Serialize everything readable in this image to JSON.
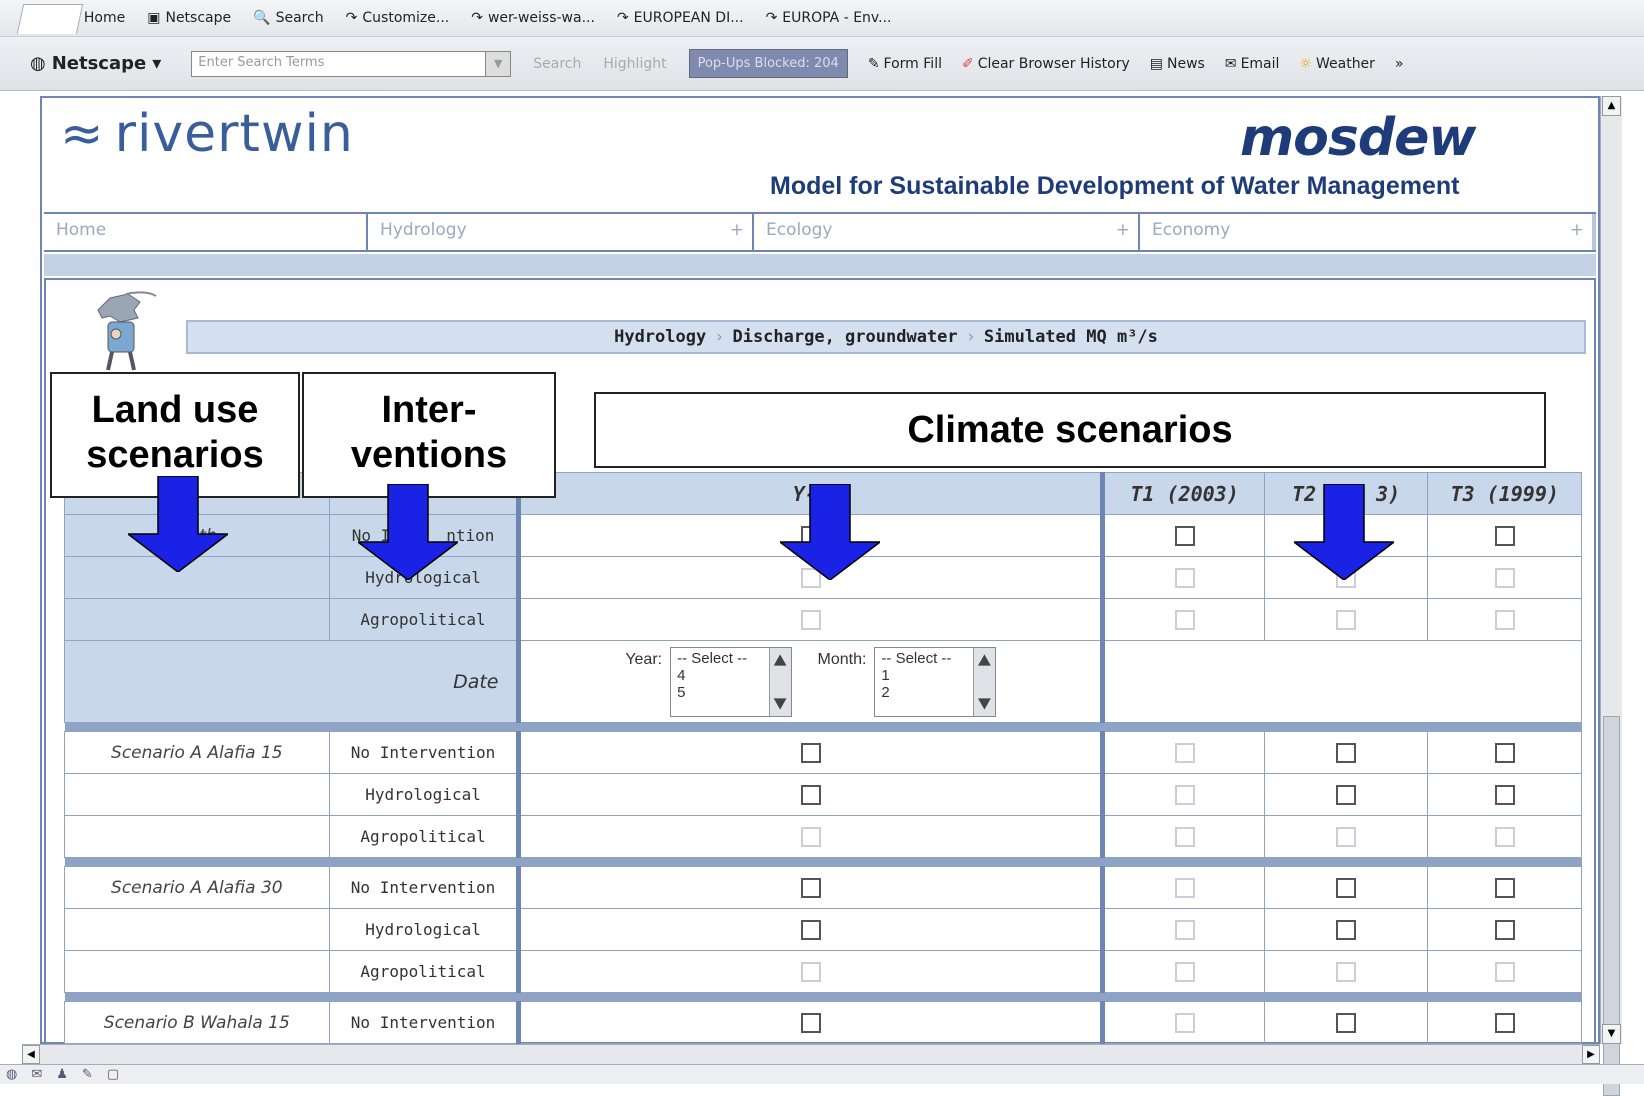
{
  "browser": {
    "bookmarks": [
      "Home",
      "Netscape",
      "Search",
      "Customize...",
      "wer-weiss-wa...",
      "EUROPEAN DI...",
      "EUROPA - Env..."
    ],
    "netscape_label": "Netscape",
    "search_placeholder": "Enter Search Terms",
    "search_btn": "Search",
    "highlight_btn": "Highlight",
    "popups_blocked": "Pop-Ups Blocked: 204",
    "form_fill": "Form Fill",
    "clear_history": "Clear Browser History",
    "news": "News",
    "email": "Email",
    "weather": "Weather",
    "more": "»"
  },
  "site": {
    "logo_text": "rivertwin",
    "brand": "mosdew",
    "subtitle": "Model for Sustainable Development of Water Management",
    "accent_color": "#1f3c7a",
    "nav": [
      {
        "label": "Home",
        "has_plus": false
      },
      {
        "label": "Hydrology",
        "has_plus": true
      },
      {
        "label": "Ecology",
        "has_plus": true
      },
      {
        "label": "Economy",
        "has_plus": true
      }
    ],
    "nav_plus": "+"
  },
  "breadcrumb": {
    "items": [
      "Hydrology",
      "Discharge, groundwater",
      "Simulated MQ m³/s"
    ],
    "separator": "›"
  },
  "overlay": {
    "land_use": "Land use scenarios",
    "land_use_l1": "Land use",
    "land_use_l2": "scenarios",
    "interventions_l1": "Inter-",
    "interventions_l2": "ventions",
    "climate": "Climate scenarios"
  },
  "table": {
    "headers": [
      "Y-B",
      "T1 (2003)",
      "T2",
      "3)",
      "T3 (1999)"
    ],
    "rows": [
      {
        "landuse": "owth",
        "intervention": "No I",
        "intervention_tail": "ntion"
      },
      {
        "landuse": "",
        "intervention": "Hydrological"
      },
      {
        "landuse": "",
        "intervention": "Agropolitical"
      }
    ],
    "date_label": "Date",
    "year_label": "Year:",
    "month_label": "Month:",
    "year_options": [
      "-- Select --",
      "4",
      "5"
    ],
    "month_options": [
      "-- Select --",
      "1",
      "2"
    ],
    "groups": [
      {
        "landuse": "Scenario A Alafia 15",
        "rows": [
          {
            "intervention": "No Intervention",
            "checks": [
              true,
              false,
              true,
              true
            ]
          },
          {
            "intervention": "Hydrological",
            "checks": [
              true,
              false,
              true,
              true
            ]
          },
          {
            "intervention": "Agropolitical",
            "checks": [
              false,
              false,
              false,
              false
            ]
          }
        ]
      },
      {
        "landuse": "Scenario A Alafia 30",
        "rows": [
          {
            "intervention": "No Intervention",
            "checks": [
              true,
              false,
              true,
              true
            ]
          },
          {
            "intervention": "Hydrological",
            "checks": [
              true,
              false,
              true,
              true
            ]
          },
          {
            "intervention": "Agropolitical",
            "checks": [
              false,
              false,
              false,
              false
            ]
          }
        ]
      },
      {
        "landuse": "Scenario B Wahala 15",
        "rows": [
          {
            "intervention": "No Intervention",
            "checks": [
              true,
              false,
              true,
              true
            ]
          }
        ]
      }
    ]
  },
  "arrow_color": "#1a22e6"
}
